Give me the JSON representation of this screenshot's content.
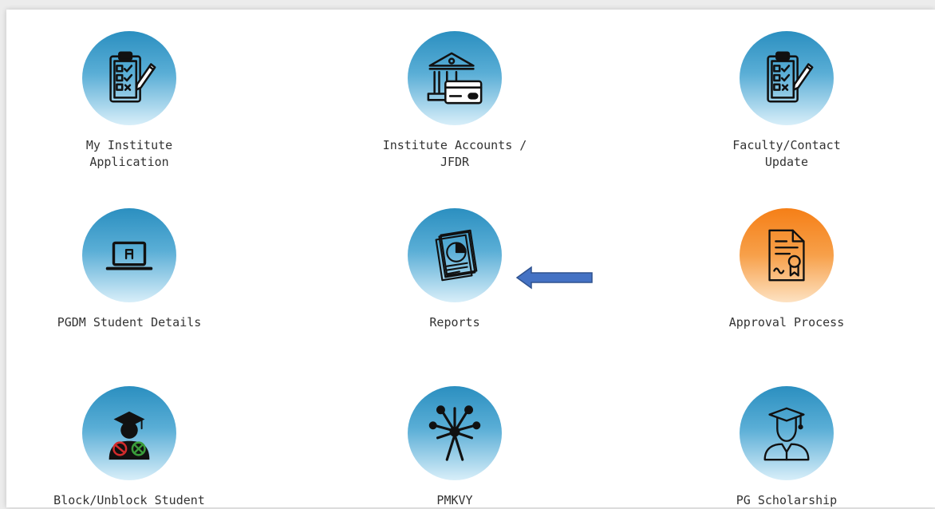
{
  "tiles": [
    {
      "label": "My Institute\nApplication",
      "icon": "checklist-icon"
    },
    {
      "label": "Institute Accounts /\nJFDR",
      "icon": "bank-card-icon"
    },
    {
      "label": "Faculty/Contact\nUpdate",
      "icon": "checklist-icon"
    },
    {
      "label": "PGDM Student Details",
      "icon": "laptop-profile-icon"
    },
    {
      "label": "Reports",
      "icon": "pie-chart-report-icon"
    },
    {
      "label": "Approval Process",
      "icon": "certificate-icon"
    },
    {
      "label": "Block/Unblock Student",
      "icon": "student-block-icon"
    },
    {
      "label": "PMKVY",
      "icon": "people-star-icon"
    },
    {
      "label": "PG Scholarship",
      "icon": "graduate-icon"
    }
  ],
  "annotation": {
    "icon": "left-arrow-icon",
    "color": "#4472c4"
  },
  "colors": {
    "icon_blue": "#2b8fc0",
    "icon_orange": "#f57f17",
    "label_text": "#333333"
  }
}
